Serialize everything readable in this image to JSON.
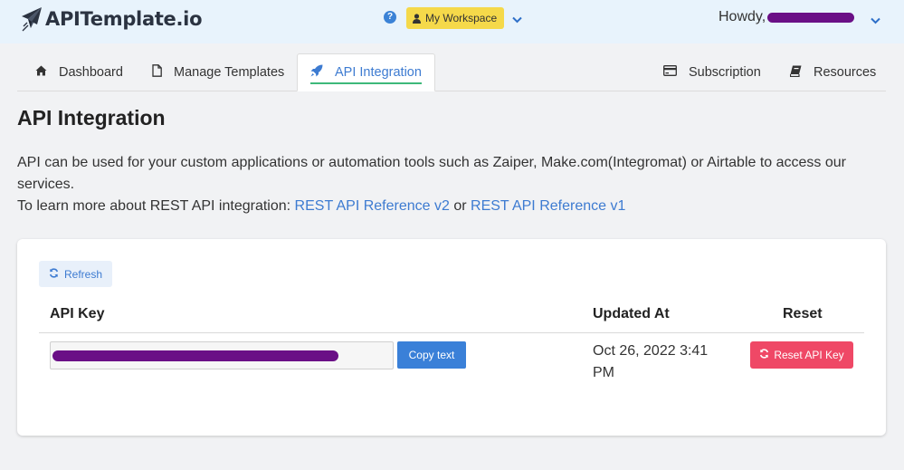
{
  "app": {
    "logo_text": "APITemplate.io",
    "help_icon": "question-circle-icon",
    "workspace_label": "My Workspace",
    "greeting": "Howdy,",
    "username_redacted": true
  },
  "tabs": [
    {
      "label": "Dashboard",
      "icon": "home-icon",
      "active": false
    },
    {
      "label": "Manage Templates",
      "icon": "file-icon",
      "active": false
    },
    {
      "label": "API Integration",
      "icon": "rocket-icon",
      "active": true
    },
    {
      "label": "Subscription",
      "icon": "credit-card-icon",
      "active": false
    },
    {
      "label": "Resources",
      "icon": "book-icon",
      "active": false
    }
  ],
  "page": {
    "title": "API Integration",
    "description_line1": "API can be used for your custom applications or automation tools such as Zaiper, Make.com(Integromat) or Airtable to access our services.",
    "description_line2_prefix": "To learn more about REST API integration: ",
    "link_v2": "REST API Reference v2",
    "link_sep": " or ",
    "link_v1": "REST API Reference v1"
  },
  "card": {
    "refresh_label": "Refresh",
    "columns": [
      "API Key",
      "Updated At",
      "Reset"
    ],
    "row": {
      "api_key_redacted": true,
      "copy_label": "Copy text",
      "updated_at": "Oct 26, 2022 3:41 PM",
      "reset_label": "Reset API Key"
    }
  },
  "colors": {
    "topbar_bg": "#e8f3fc",
    "workspace_bg": "#f5d94a",
    "link": "#3d7bd1",
    "active_underline": "#3db87a",
    "copy_btn": "#3a80d8",
    "reset_btn": "#ef4866",
    "redaction": "#6a0f86"
  }
}
